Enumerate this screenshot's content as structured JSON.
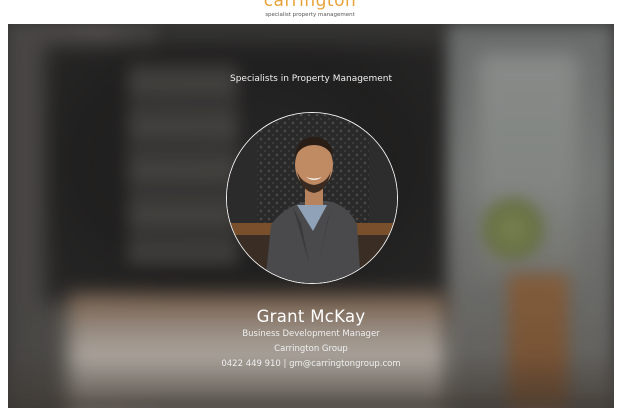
{
  "logo": {
    "name": "carrington",
    "tagline": "specialist property management"
  },
  "hero": {
    "tagline": "Specialists in Property Management"
  },
  "profile": {
    "name": "Grant McKay",
    "role": "Business Development Manager",
    "company": "Carrington Group",
    "contact": "0422 449 910 | gm@carringtongroup.com"
  },
  "colors": {
    "brand_accent": "#e8a33a",
    "text_light": "#ffffff"
  }
}
